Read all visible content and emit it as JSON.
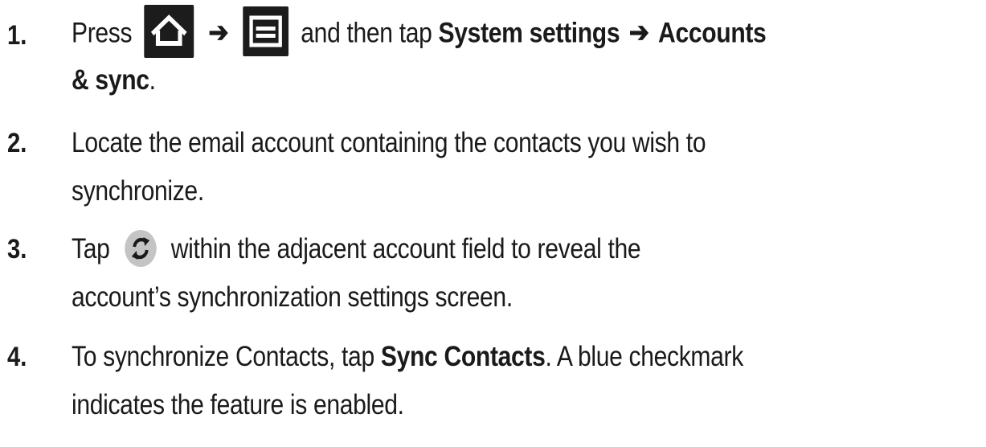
{
  "steps": [
    {
      "number": "1.",
      "line1": {
        "press": "Press",
        "arrow1": "➔",
        "and_then": "and then tap",
        "system_settings": "System settings",
        "arrow2": "➔",
        "accounts": "Accounts"
      },
      "line2": {
        "sync": "& sync",
        "period": "."
      }
    },
    {
      "number": "2.",
      "line1": "Locate the email account containing the contacts you wish to",
      "line2": "synchronize."
    },
    {
      "number": "3.",
      "line1": {
        "tap": "Tap",
        "rest": "within the adjacent account field to reveal the"
      },
      "line2": "account’s synchronization settings screen."
    },
    {
      "number": "4.",
      "line1": {
        "before": "To synchronize Contacts, tap",
        "bold": "Sync Contacts",
        "after": ". A blue checkmark"
      },
      "line2": "indicates the feature is enabled."
    }
  ],
  "icons": {
    "home": "home-icon",
    "menu": "menu-icon",
    "sync": "sync-icon"
  }
}
